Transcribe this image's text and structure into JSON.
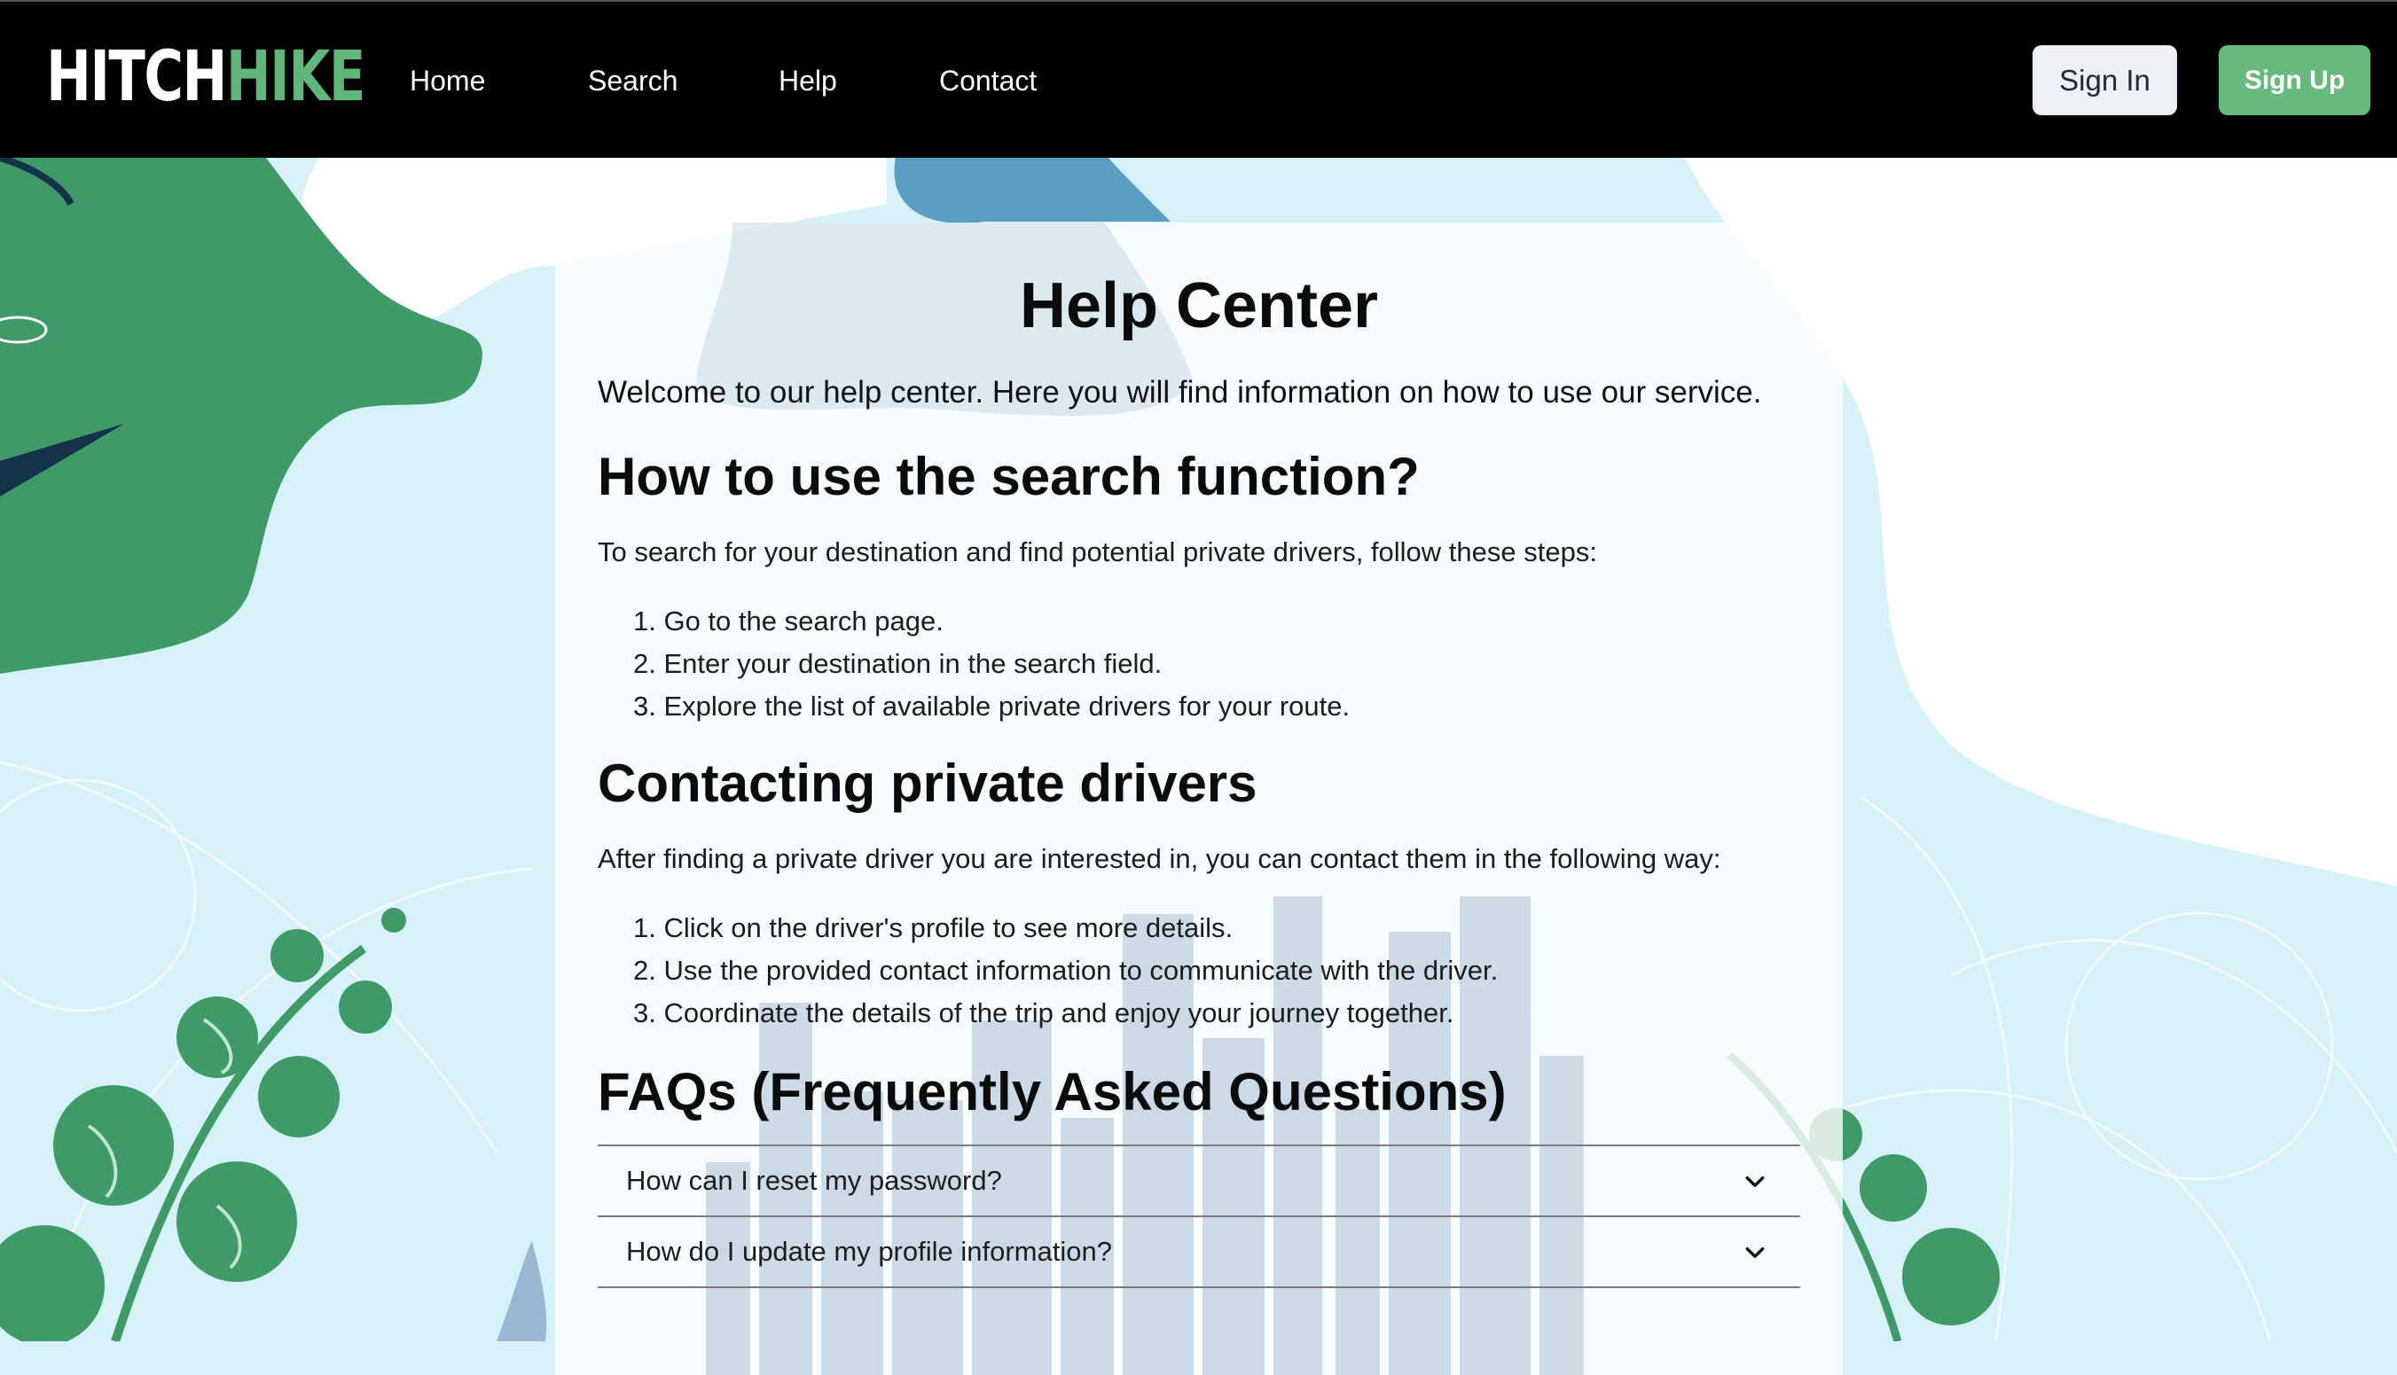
{
  "header": {
    "logo": {
      "part1": "HITCH",
      "part2": "HIKE"
    },
    "nav": [
      {
        "label": "Home"
      },
      {
        "label": "Search"
      },
      {
        "label": "Help"
      },
      {
        "label": "Contact"
      }
    ],
    "sign_in_label": "Sign In",
    "sign_up_label": "Sign Up"
  },
  "help": {
    "title": "Help Center",
    "welcome": "Welcome to our help center. Here you will find information on how to use our service.",
    "sections": [
      {
        "heading": "How to use the search function?",
        "intro": "To search for your destination and find potential private drivers, follow these steps:",
        "steps": [
          "1. Go to the search page.",
          "2. Enter your destination in the search field.",
          "3. Explore the list of available private drivers for your route."
        ]
      },
      {
        "heading": "Contacting private drivers",
        "intro": "After finding a private driver you are interested in, you can contact them in the following way:",
        "steps": [
          "1. Click on the driver's profile to see more details.",
          "2. Use the provided contact information to communicate with the driver.",
          "3. Coordinate the details of the trip and enjoy your journey together."
        ]
      }
    ],
    "faq_heading": "FAQs (Frequently Asked Questions)",
    "faqs": [
      {
        "question": "How can I reset my password?",
        "icon": "chevron-down-icon"
      },
      {
        "question": "How do I update my profile information?",
        "icon": "chevron-down-icon"
      }
    ]
  },
  "colors": {
    "header_bg": "#000000",
    "brand_green": "#5fb77a",
    "signup_bg": "#67b97e",
    "signin_bg": "#eceff3",
    "page_bg": "#d6f1f8",
    "leaf_green": "#3f9a68"
  }
}
